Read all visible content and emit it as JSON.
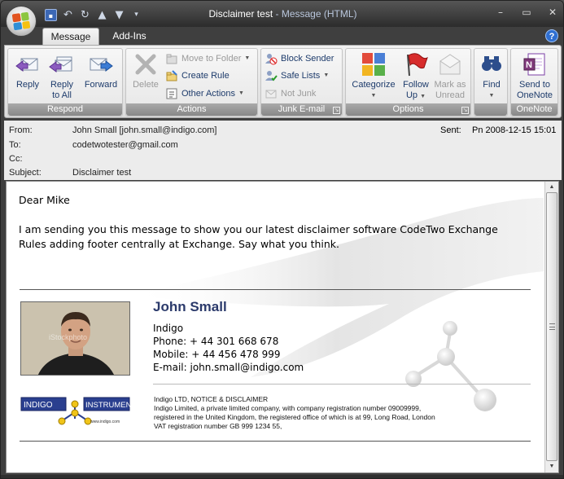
{
  "window": {
    "title_doc": "Disclaimer test",
    "title_sep": " - ",
    "title_app": "Message (HTML)",
    "controls": [
      "–",
      "▭",
      "✕"
    ]
  },
  "qat": {
    "icons": [
      "save-icon",
      "undo-icon",
      "redo-icon",
      "previous-item-icon",
      "next-item-icon",
      "customize-icon"
    ]
  },
  "tabs": [
    {
      "label": "Message",
      "active": true
    },
    {
      "label": "Add-Ins",
      "active": false
    }
  ],
  "ribbon": {
    "groups": {
      "respond": "Respond",
      "actions": "Actions",
      "junk": "Junk E-mail",
      "options": "Options",
      "find": "",
      "onenote": "OneNote"
    },
    "reply": "Reply",
    "reply_all_1": "Reply",
    "reply_all_2": "to All",
    "forward": "Forward",
    "delete": "Delete",
    "move_to_folder": "Move to Folder",
    "create_rule": "Create Rule",
    "other_actions": "Other Actions",
    "block_sender": "Block Sender",
    "safe_lists": "Safe Lists",
    "not_junk": "Not Junk",
    "categorize": "Categorize",
    "follow_up_1": "Follow",
    "follow_up_2": "Up",
    "mark_unread_1": "Mark as",
    "mark_unread_2": "Unread",
    "find": "Find",
    "send_onenote_1": "Send to",
    "send_onenote_2": "OneNote"
  },
  "header": {
    "from_label": "From:",
    "from_value": "John Small [john.small@indigo.com]",
    "to_label": "To:",
    "to_value": "codetwotester@gmail.com",
    "cc_label": "Cc:",
    "cc_value": "",
    "subject_label": "Subject:",
    "subject_value": "Disclaimer test",
    "sent_label": "Sent:",
    "sent_value": "Pn 2008-12-15 15:01"
  },
  "message": {
    "greeting": "Dear Mike",
    "paragraph": "I am sending you this message to show you our latest disclaimer software CodeTwo Exchange Rules adding footer centrally at Exchange. Say what you think."
  },
  "signature": {
    "name": "John Small",
    "company": "Indigo",
    "phone": "Phone: + 44 301 668 678",
    "mobile": "Mobile:  + 44 456 478 999",
    "email": "E-mail: john.small@indigo.com",
    "photo_watermark": "iStockphoto",
    "logo_left": "INDIGO",
    "logo_right": "INSTRUMENTS",
    "logo_url": "www.indigo.com",
    "disclaimer": [
      "Indigo LTD, NOTICE & DISCLAIMER",
      "Indigo Limited, a private limited company, with company registration number 09009999,",
      "registered in the United Kingdom, the registered office of which is at 99, Long Road, London",
      "VAT registration number GB 999 1234 55,"
    ]
  },
  "colors": {
    "signature_name": "#2b3a6b",
    "accent_blue": "#2f6fd1",
    "ribbon_text": "#1d3b6b"
  }
}
